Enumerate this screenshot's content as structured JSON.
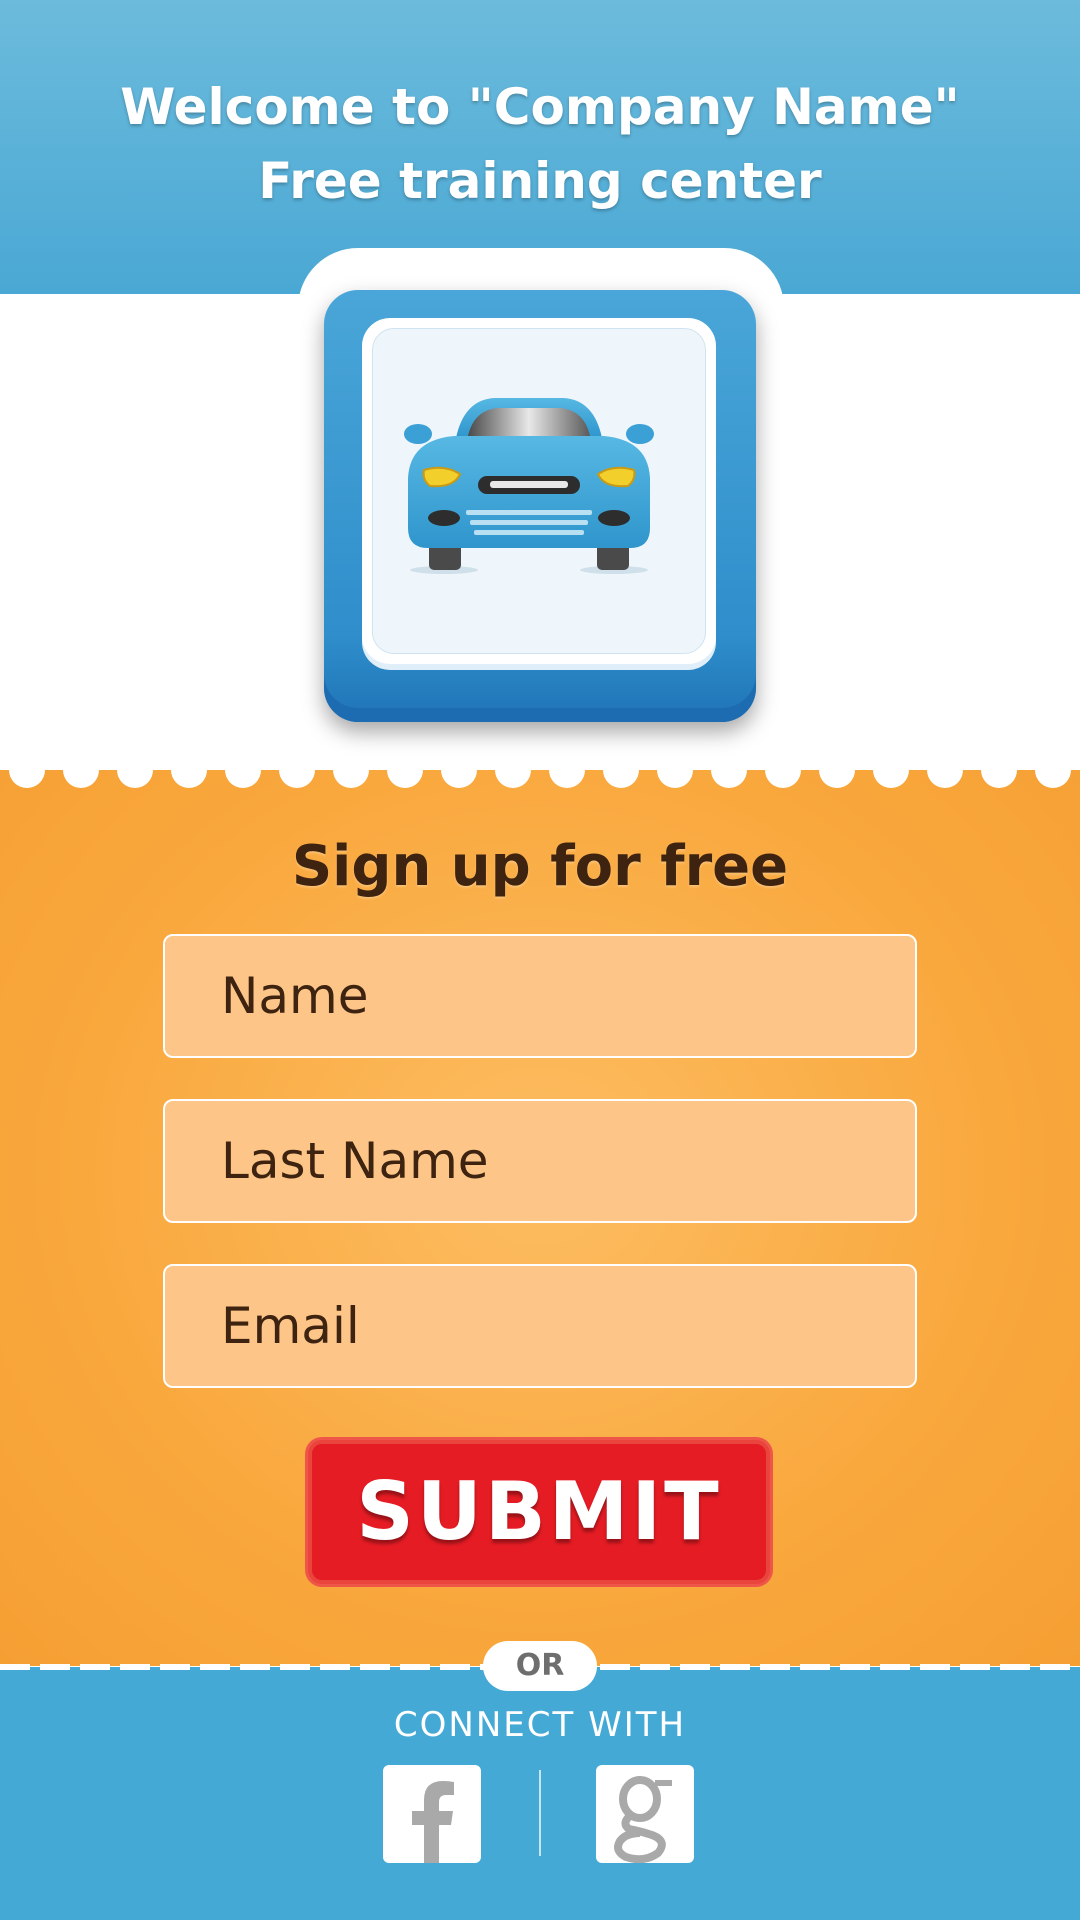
{
  "header": {
    "title_line1": "Welcome to \"Company Name\"",
    "title_line2": "Free training center"
  },
  "app_icon": {
    "icon": "car-icon"
  },
  "form": {
    "title": "Sign up for free",
    "name_placeholder": "Name",
    "last_name_placeholder": "Last Name",
    "email_placeholder": "Email",
    "submit_label": "SUBMIT"
  },
  "divider": {
    "or_label": "OR"
  },
  "footer": {
    "connect_label": "CONNECT WITH",
    "social": [
      {
        "icon": "facebook-icon"
      },
      {
        "icon": "google-icon"
      }
    ]
  },
  "colors": {
    "header_blue": "#4aa8d4",
    "form_orange": "#f9a83d",
    "field_fill": "#fdc688",
    "submit_red": "#e61c24",
    "footer_blue": "#45a9d6",
    "text_dark": "#3d2310"
  }
}
